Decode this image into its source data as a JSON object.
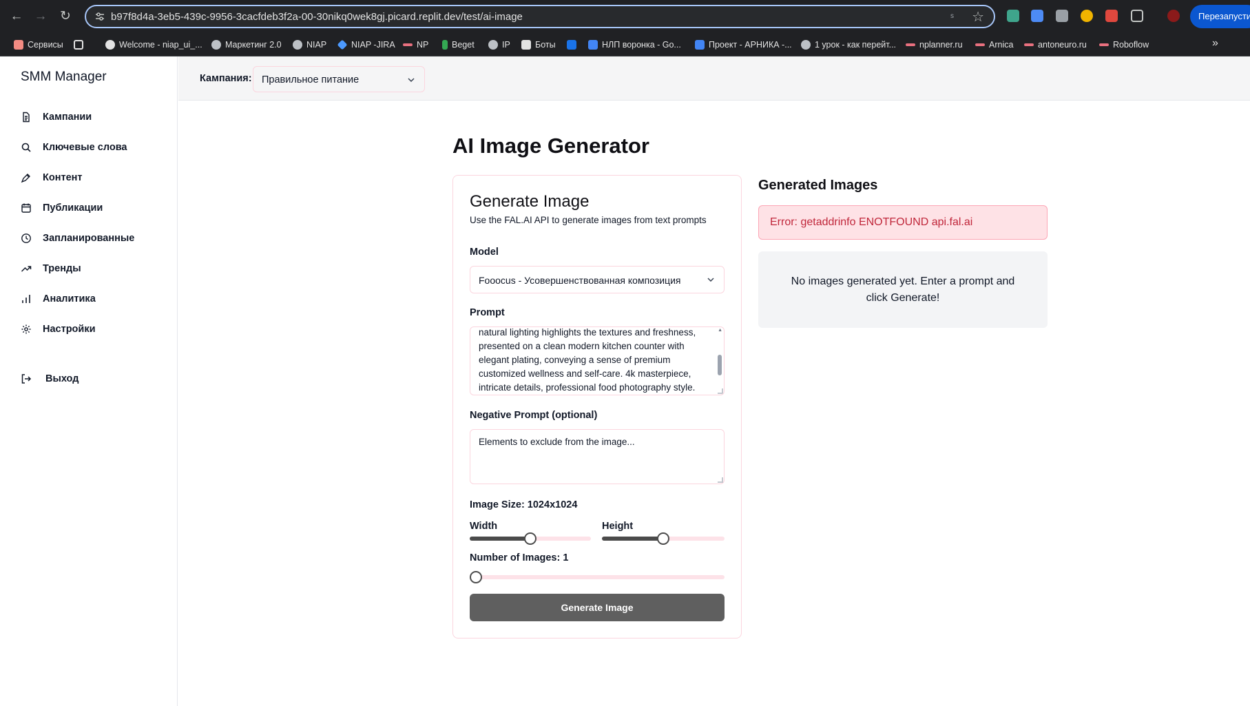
{
  "browser": {
    "url": "b97f8d4a-3eb5-439c-9956-3cacfdeb3f2a-00-30nikq0wek8gj.picard.replit.dev/test/ai-image",
    "profile_hint": "s",
    "restart_label": "Перезапустить",
    "bookmarks": [
      {
        "label": "Сервисы",
        "icon": "apps-icon",
        "color": "#f28b82"
      },
      {
        "label": "",
        "icon": "grid-icon",
        "color": "#e3e3e3"
      },
      {
        "label": "Welcome - niap_ui_...",
        "icon": "github-icon",
        "color": "#e3e3e3"
      },
      {
        "label": "Маркетинг 2.0",
        "icon": "globe-icon",
        "color": "#bdc1c6"
      },
      {
        "label": "NIAP",
        "icon": "globe-icon",
        "color": "#bdc1c6"
      },
      {
        "label": "NIAP -JIRA",
        "icon": "jira-icon",
        "color": "#4c9aff"
      },
      {
        "label": "NP",
        "icon": "link-icon",
        "color": "#e8707f"
      },
      {
        "label": "Beget",
        "icon": "beget-icon",
        "color": "#34a853"
      },
      {
        "label": "IP",
        "icon": "globe-icon",
        "color": "#bdc1c6"
      },
      {
        "label": "Боты",
        "icon": "bots-icon",
        "color": "#e3e3e3"
      },
      {
        "label": "",
        "icon": "trello-icon",
        "color": "#1a73e8"
      },
      {
        "label": "НЛП воронка - Go...",
        "icon": "docs-icon",
        "color": "#4285f4"
      },
      {
        "label": "Проект - АРНИКА -...",
        "icon": "docs-icon",
        "color": "#4285f4"
      },
      {
        "label": "1 урок - как перейт...",
        "icon": "globe-icon",
        "color": "#bdc1c6"
      },
      {
        "label": "nplanner.ru",
        "icon": "link-icon",
        "color": "#e8707f"
      },
      {
        "label": "Arnica",
        "icon": "link-icon",
        "color": "#e8707f"
      },
      {
        "label": "antoneuro.ru",
        "icon": "link-icon",
        "color": "#e8707f"
      },
      {
        "label": "Roboflow",
        "icon": "link-icon",
        "color": "#e8707f"
      }
    ]
  },
  "app": {
    "brand": "SMM Manager",
    "nav": [
      {
        "label": "Кампании",
        "icon": "document-icon"
      },
      {
        "label": "Ключевые слова",
        "icon": "search-icon"
      },
      {
        "label": "Контент",
        "icon": "pen-icon"
      },
      {
        "label": "Публикации",
        "icon": "calendar-icon"
      },
      {
        "label": "Запланированные",
        "icon": "clock-icon"
      },
      {
        "label": "Тренды",
        "icon": "trending-icon"
      },
      {
        "label": "Аналитика",
        "icon": "bar-chart-icon"
      },
      {
        "label": "Настройки",
        "icon": "settings-icon"
      }
    ],
    "logout_label": "Выход",
    "campaign": {
      "label": "Кампания:",
      "value": "Правильное питание"
    }
  },
  "page": {
    "title": "AI Image Generator",
    "form": {
      "title": "Generate Image",
      "subtitle": "Use the FAL.AI API to generate images from text prompts",
      "model_label": "Model",
      "model_value": "Fooocus - Усовершенствованная композиция",
      "prompt_label": "Prompt",
      "prompt_value": "natural lighting highlights the textures and freshness, presented on a clean modern kitchen counter with elegant plating, conveying a sense of premium customized wellness and self-care. 4k masterpiece, intricate details, professional food photography style.",
      "negative_label": "Negative Prompt (optional)",
      "negative_placeholder": "Elements to exclude from the image...",
      "size_label": "Image Size: 1024x1024",
      "width_label": "Width",
      "width_level": 0.5,
      "height_label": "Height",
      "height_level": 0.5,
      "count_label": "Number of Images: 1",
      "count_level": 0.0,
      "submit_label": "Generate Image"
    },
    "results": {
      "title": "Generated Images",
      "error": "Error: getaddrinfo ENOTFOUND api.fal.ai",
      "empty": "No images generated yet. Enter a prompt and click Generate!"
    }
  }
}
